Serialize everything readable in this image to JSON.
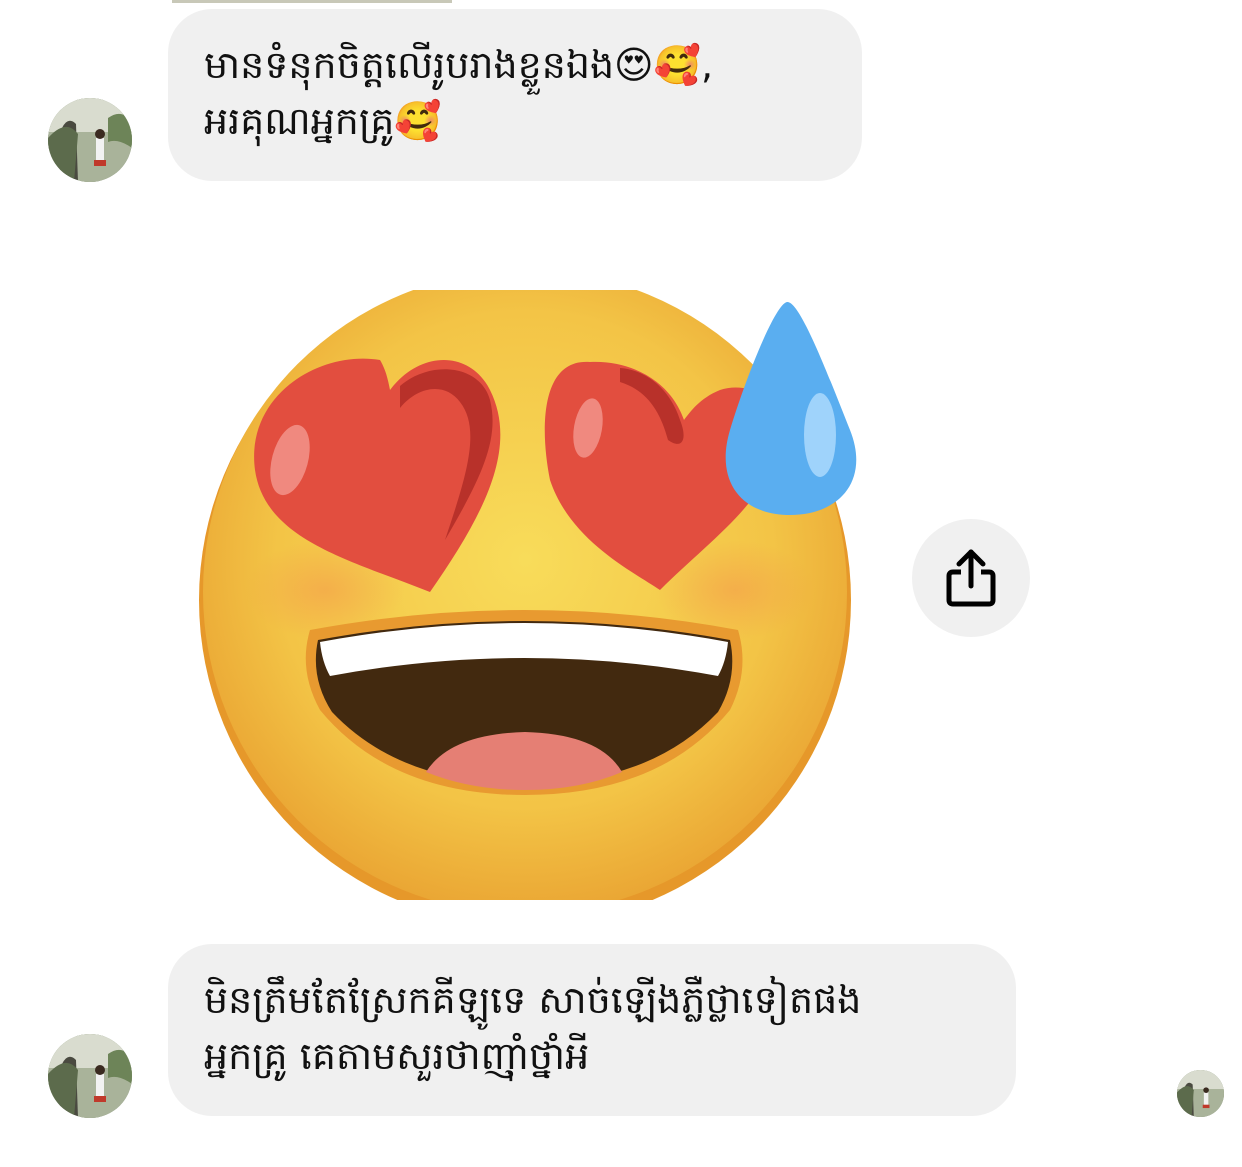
{
  "messages": [
    {
      "sender": "other",
      "lines": [
        "មានទំនុកចិត្តលើរូបរាងខ្លួនឯង😍🥰,",
        "អរគុណអ្នកគ្រូ🥰"
      ]
    },
    {
      "sender": "other",
      "type": "sticker",
      "sticker": "heart-eyes-sweat-drop-emoji"
    },
    {
      "sender": "other",
      "lines": [
        "មិនត្រឹមតែស្រែកគីឡូទេ សាច់ឡើងភ្លឺថ្លាទៀតផង",
        "អ្នកគ្រូ គេតាមសួរថាញ៉ាំថ្នាំអី"
      ]
    }
  ],
  "share_button": {
    "icon": "share-icon"
  },
  "colors": {
    "bubble_bg": "#f0f0f0",
    "emoji_face": "#f6c84a",
    "heart": "#e24e3f",
    "drop": "#5aaef0"
  }
}
